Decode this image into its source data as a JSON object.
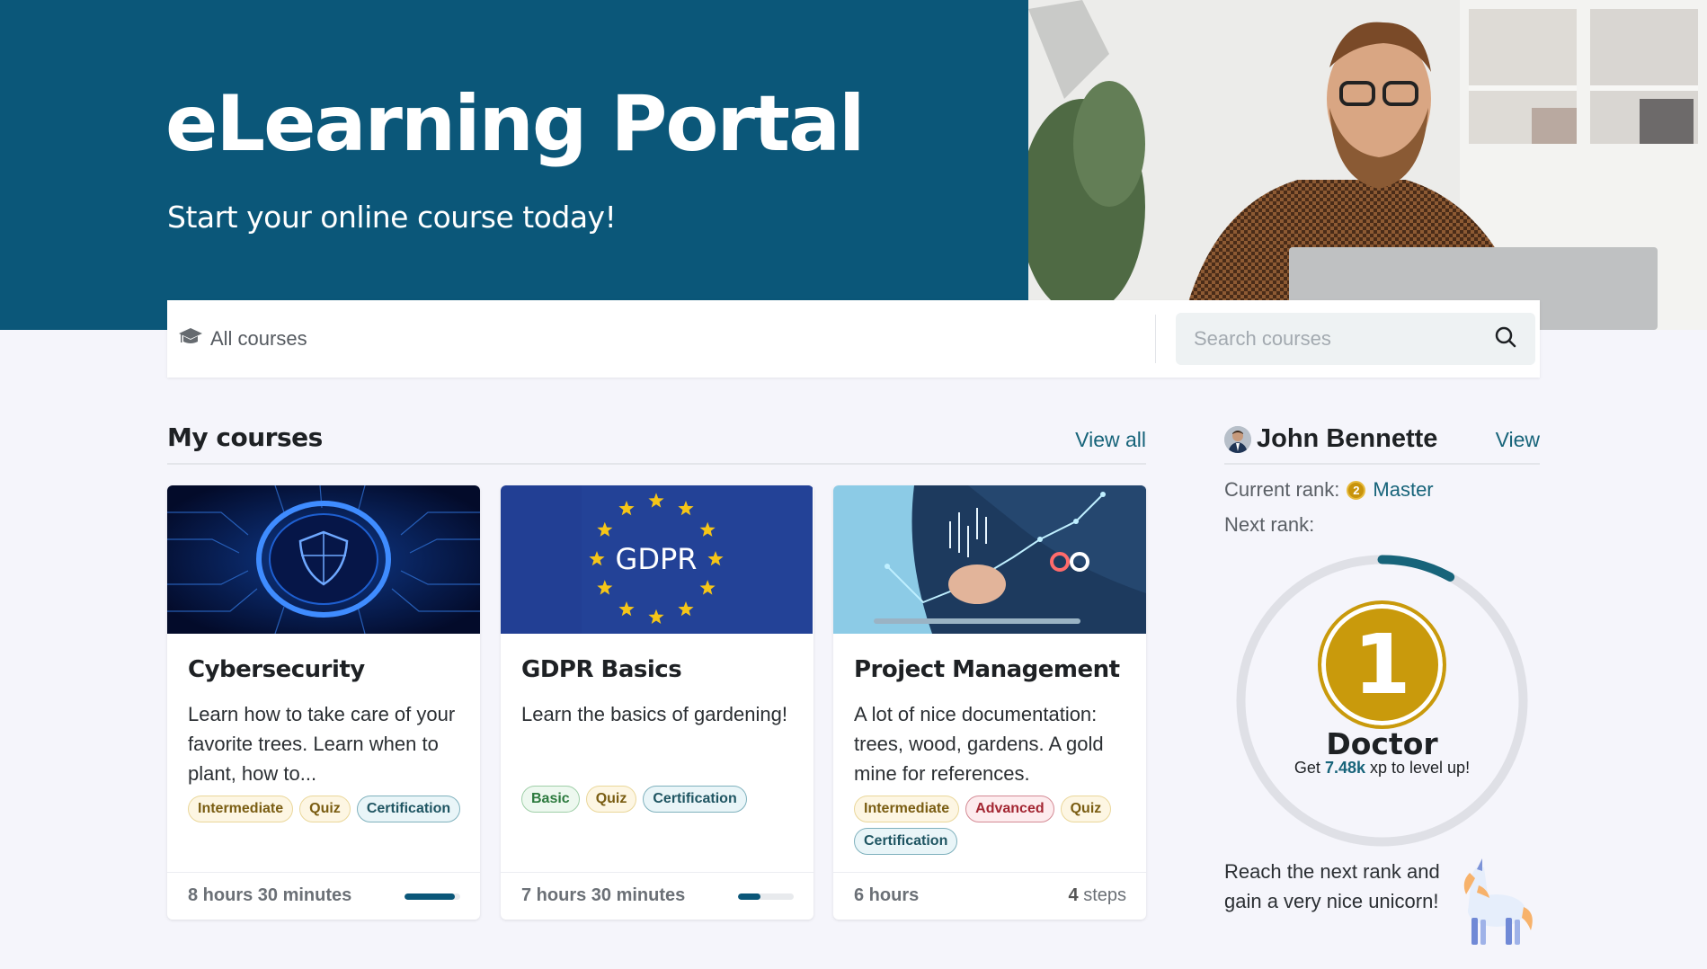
{
  "hero": {
    "title": "eLearning Portal",
    "subtitle": "Start your online course today!",
    "accent_color": "#0b5779"
  },
  "filter_bar": {
    "all_courses_label": "All courses",
    "all_courses_icon": "graduation-cap-icon",
    "search_placeholder": "Search courses",
    "search_value": "",
    "search_icon": "search-icon"
  },
  "my_courses": {
    "title": "My courses",
    "view_all_label": "View all",
    "courses": [
      {
        "title": "Cybersecurity",
        "image": "shield-circuit-image",
        "description": "Learn how to take care of your favorite trees. Learn when to plant, how to...",
        "tags": [
          {
            "label": "Intermediate",
            "type": "intermediate"
          },
          {
            "label": "Quiz",
            "type": "quiz"
          },
          {
            "label": "Certification",
            "type": "certification"
          }
        ],
        "duration": "8 hours 30 minutes",
        "progress_percent": 90
      },
      {
        "title": "GDPR Basics",
        "image": "gdpr-eu-flag-image",
        "image_text": "GDPR",
        "description": "Learn the basics of gardening!",
        "tags": [
          {
            "label": "Basic",
            "type": "basic"
          },
          {
            "label": "Quiz",
            "type": "quiz"
          },
          {
            "label": "Certification",
            "type": "certification"
          }
        ],
        "duration": "7 hours 30 minutes",
        "progress_percent": 40
      },
      {
        "title": "Project Management",
        "image": "business-analytics-image",
        "description": "A lot of nice documentation: trees, wood, gardens. A gold mine for references.",
        "tags": [
          {
            "label": "Intermediate",
            "type": "intermediate"
          },
          {
            "label": "Advanced",
            "type": "advanced"
          },
          {
            "label": "Quiz",
            "type": "quiz"
          },
          {
            "label": "Certification",
            "type": "certification"
          }
        ],
        "duration": "6 hours",
        "steps_count": "4",
        "steps_label": "steps"
      }
    ]
  },
  "profile": {
    "name": "John Bennette",
    "view_label": "View",
    "current_rank_label": "Current rank:",
    "current_rank_number": "2",
    "current_rank_name": "Master",
    "next_rank_label": "Next rank:",
    "next_rank_number": "1",
    "next_rank_name": "Doctor",
    "xp_prefix": "Get",
    "xp_value": "7.48k",
    "xp_suffix": "xp to level up!",
    "rank_progress_percent": 8,
    "reward_text": "Reach the next rank and gain a very nice unicorn!",
    "reward_icon": "unicorn-icon"
  }
}
